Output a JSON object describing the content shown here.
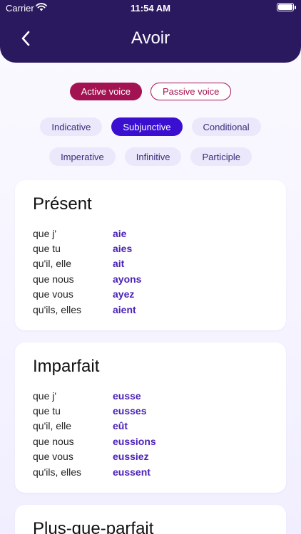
{
  "status_bar": {
    "carrier": "Carrier",
    "time": "11:54 AM",
    "battery": 1.0
  },
  "header": {
    "title": "Avoir",
    "back_icon": "chevron-left-icon"
  },
  "voice": {
    "active": "Active voice",
    "passive": "Passive voice"
  },
  "moods_row1": [
    "Indicative",
    "Subjunctive",
    "Conditional"
  ],
  "moods_row2": [
    "Imperative",
    "Infinitive",
    "Participle"
  ],
  "selected_mood": "Subjunctive",
  "colors": {
    "header_bg": "#2b1960",
    "voice_accent": "#a31352",
    "mood_selected": "#3a0fd0",
    "mood_chip": "#ebe8fb",
    "verb_text": "#4a22b8"
  },
  "tenses": [
    {
      "name": "Présent",
      "rows": [
        {
          "pronoun": "que j'",
          "form": "aie"
        },
        {
          "pronoun": "que tu",
          "form": "aies"
        },
        {
          "pronoun": "qu'il, elle",
          "form": "ait"
        },
        {
          "pronoun": "que nous",
          "form": "ayons"
        },
        {
          "pronoun": "que vous",
          "form": "ayez"
        },
        {
          "pronoun": "qu'ils, elles",
          "form": "aient"
        }
      ]
    },
    {
      "name": "Imparfait",
      "rows": [
        {
          "pronoun": "que j'",
          "form": "eusse"
        },
        {
          "pronoun": "que tu",
          "form": "eusses"
        },
        {
          "pronoun": "qu'il, elle",
          "form": "eût"
        },
        {
          "pronoun": "que nous",
          "form": "eussions"
        },
        {
          "pronoun": "que vous",
          "form": "eussiez"
        },
        {
          "pronoun": "qu'ils, elles",
          "form": "eussent"
        }
      ]
    },
    {
      "name": "Plus-que-parfait",
      "rows": []
    }
  ]
}
